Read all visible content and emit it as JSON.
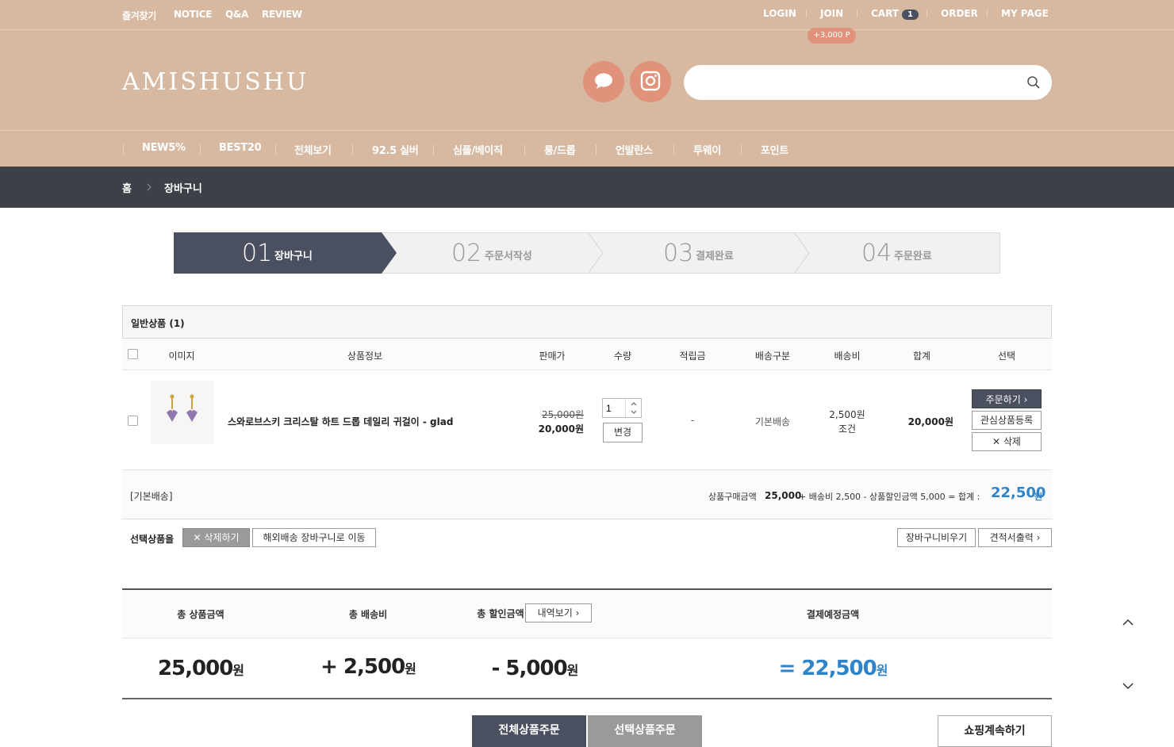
{
  "top_left_links": [
    "즐겨찾기",
    "NOTICE",
    "Q&A",
    "REVIEW"
  ],
  "top_right": {
    "login": "LOGIN",
    "join": "JOIN",
    "cart": "CART",
    "cart_count": "1",
    "order": "ORDER",
    "mypage": "MY PAGE",
    "join_point": "+3,000 P"
  },
  "logo": "AMISHUSHU",
  "search": {
    "placeholder": ""
  },
  "nav": [
    "NEW5%",
    "BEST20",
    "전체보기",
    "92.5 실버",
    "심플/베이직",
    "롱/드롭",
    "언발란스",
    "투웨이",
    "포인트"
  ],
  "breadcrumb": {
    "home": "홈",
    "current": "장바구니"
  },
  "steps": [
    {
      "num": "01",
      "label": "장바구니",
      "active": true
    },
    {
      "num": "02",
      "label": "주문서작성"
    },
    {
      "num": "03",
      "label": "결제완료"
    },
    {
      "num": "04",
      "label": "주문완료"
    }
  ],
  "cart": {
    "section_title": "일반상품 (1)",
    "headers": {
      "image": "이미지",
      "info": "상품정보",
      "price": "판매가",
      "qty": "수량",
      "points": "적립금",
      "shipping_type": "배송구분",
      "shipping_fee": "배송비",
      "total": "합계",
      "select": "선택"
    },
    "item": {
      "name": "스와로브스키 크리스탈 하트 드롭 데일리 귀걸이 - glad",
      "original_price": "25,000원",
      "price": "20,000원",
      "qty": "1",
      "change_btn": "변경",
      "points": "-",
      "shipping_type": "기본배송",
      "shipping_fee": "2,500원",
      "shipping_cond": "조건",
      "total": "20,000원",
      "order_btn": "주문하기",
      "wish_btn": "관심상품등록",
      "delete_btn": "삭제"
    },
    "summary": {
      "label": "[기본배송]",
      "text_prefix": "상품구매금액",
      "goods": "25,000",
      "mid": "+ 배송비 2,500 - 상품할인금액 5,000 = 합계 :",
      "total": "22,500",
      "won": "원"
    }
  },
  "actions": {
    "label": "선택상품을",
    "delete": "삭제하기",
    "overseas": "해외배송 장바구니로 이동",
    "empty": "장바구니비우기",
    "estimate": "견적서출력"
  },
  "totals": {
    "goods_label": "총 상품금액",
    "ship_label": "총 배송비",
    "discount_label": "총 할인금액",
    "detail_btn": "내역보기",
    "pay_label": "결제예정금액",
    "goods": "25,000",
    "ship": "+ 2,500",
    "discount": "- 5,000",
    "pay": "= 22,500",
    "won": "원"
  },
  "bottom": {
    "order_all": "전체상품주문",
    "order_selected": "선택상품주문",
    "continue": "쇼핑계속하기"
  },
  "colors": {
    "header": "#d6b9a0",
    "accent": "#e0927a",
    "dark": "#3c4047",
    "blue": "#2f83c8",
    "step_active": "#4b5060"
  }
}
